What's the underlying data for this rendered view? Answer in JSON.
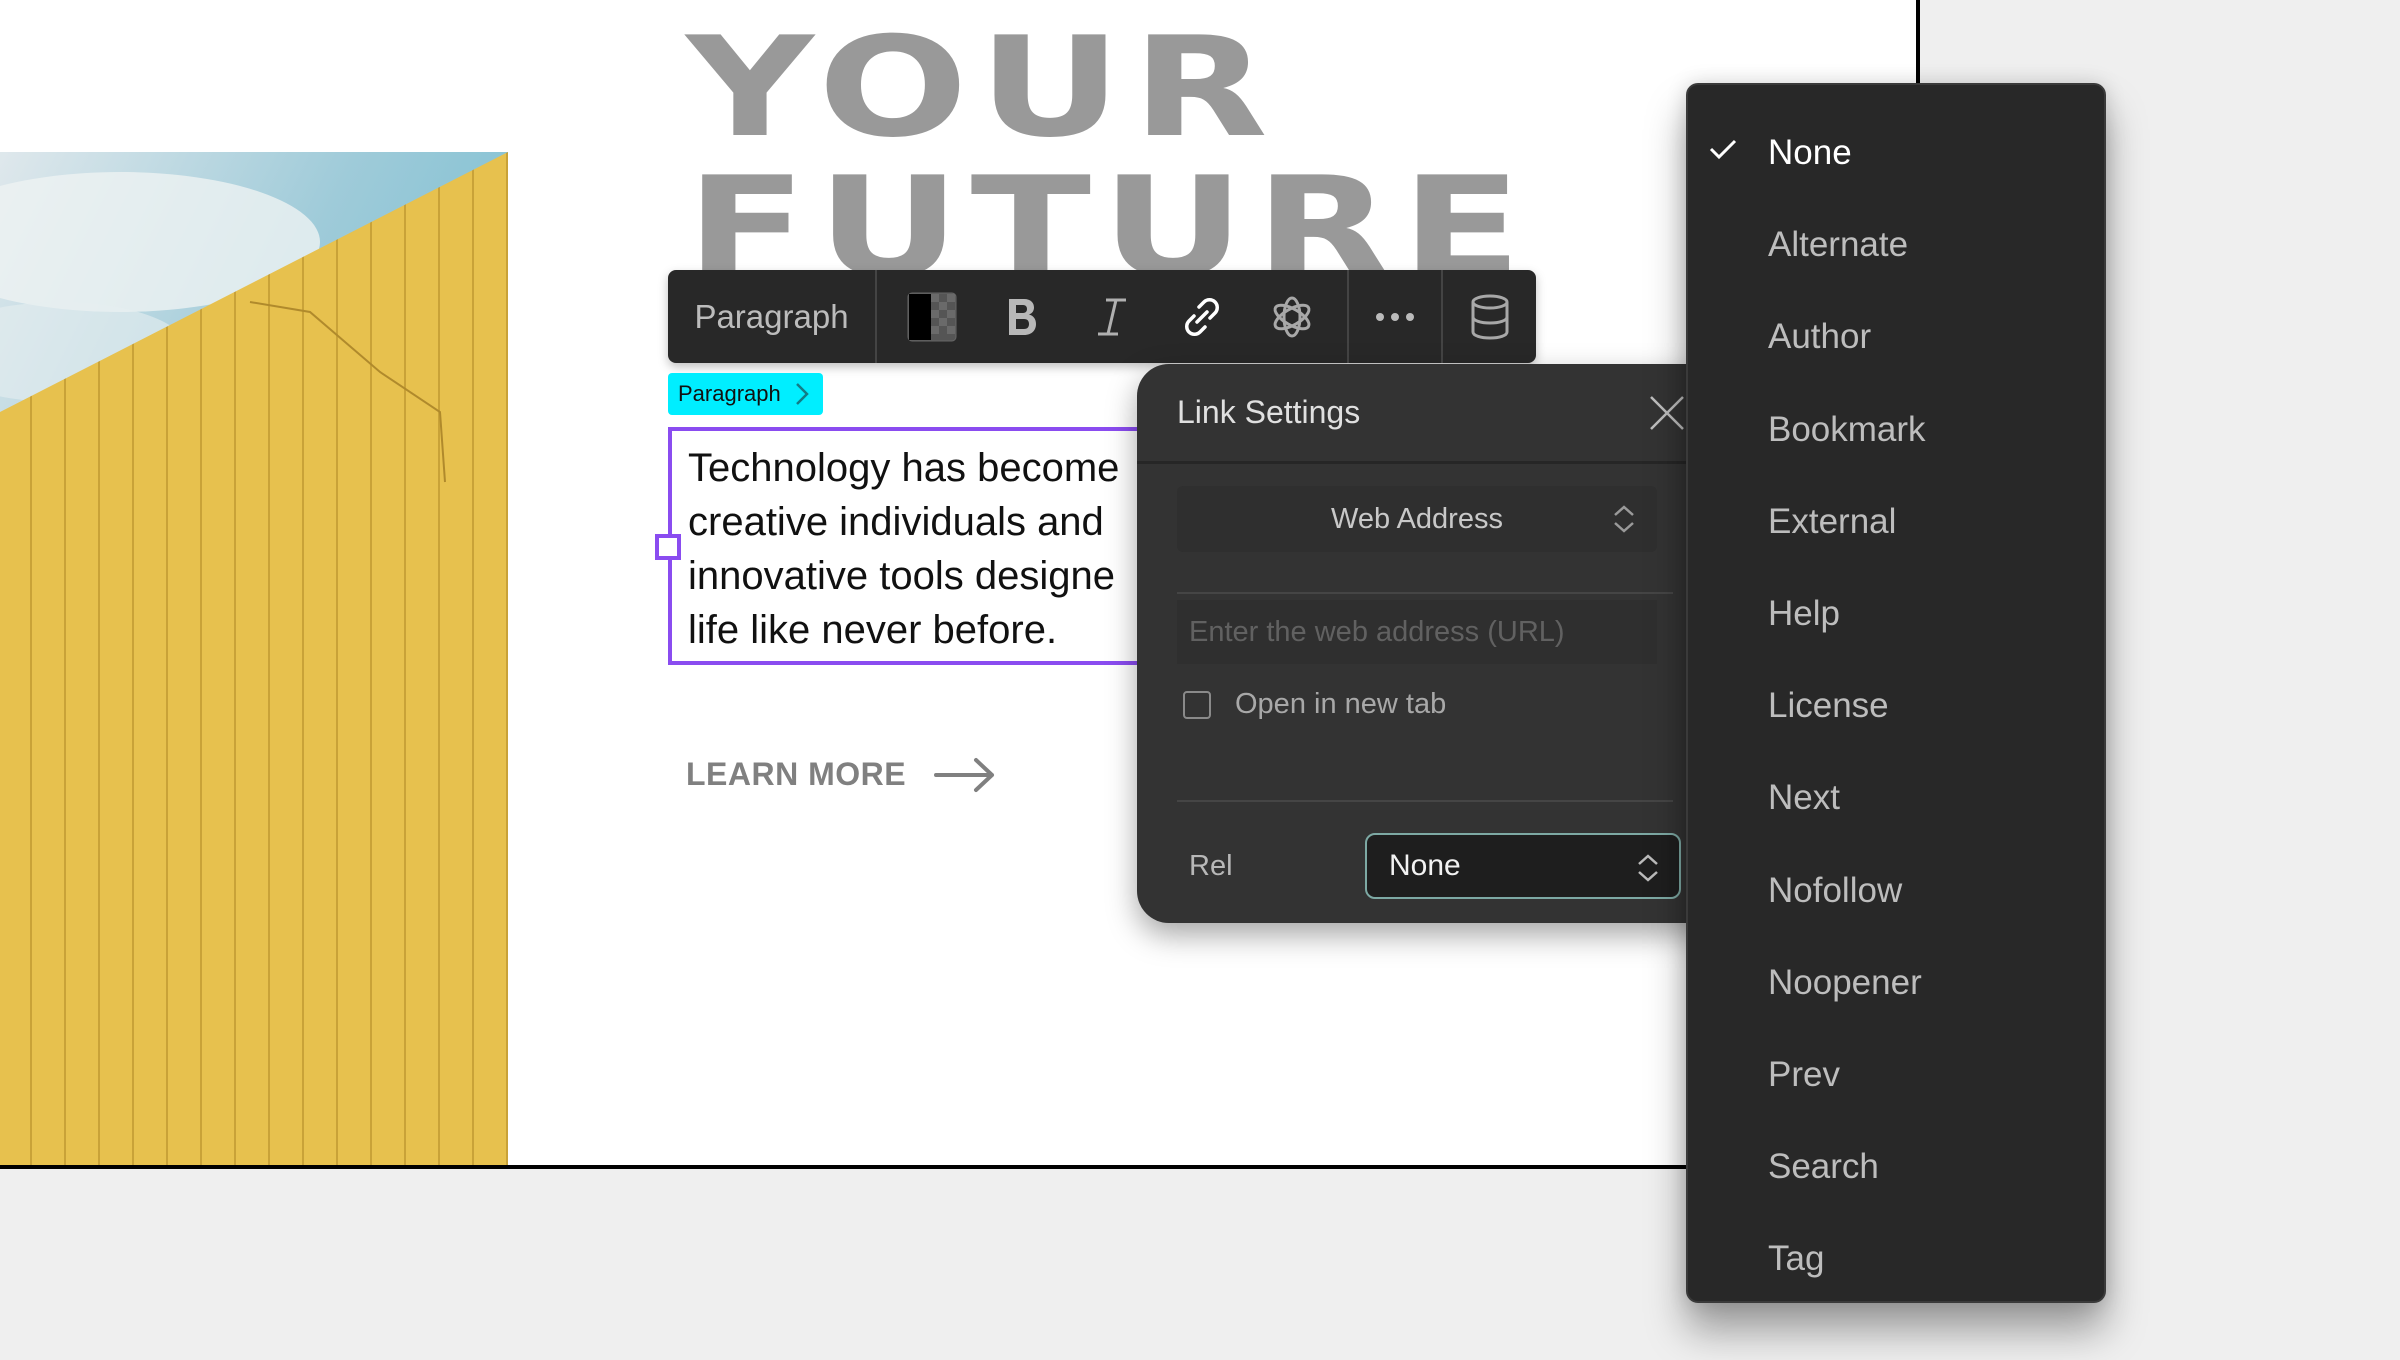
{
  "canvas": {
    "headline": [
      "YOUR",
      "FUTURE"
    ],
    "body_text_lines": [
      "Technology has become",
      "creative individuals and",
      "innovative tools designe",
      "life like never before."
    ],
    "cta": {
      "label": "LEARN MORE",
      "icon": "arrow-right-icon"
    },
    "hero_image": {
      "description": "Yellow building wall against blue sky with clouds"
    }
  },
  "toolbar": {
    "element_type": "Paragraph",
    "buttons": [
      {
        "name": "color-swatch",
        "icon": "color-swatch-icon"
      },
      {
        "name": "bold",
        "icon": "bold-icon",
        "label": "B"
      },
      {
        "name": "italic",
        "icon": "italic-icon"
      },
      {
        "name": "link",
        "icon": "link-icon",
        "active": true
      },
      {
        "name": "ai",
        "icon": "openai-icon"
      },
      {
        "name": "more",
        "icon": "more-horizontal-icon"
      },
      {
        "name": "database",
        "icon": "database-icon"
      }
    ]
  },
  "breadcrumb_badge": {
    "label": "Paragraph",
    "icon": "chevron-right-icon"
  },
  "link_settings": {
    "title": "Link Settings",
    "link_type": "Web Address",
    "url_value": "",
    "url_placeholder": "Enter the web address (URL)",
    "open_new_tab_label": "Open in new tab",
    "open_new_tab_checked": false,
    "rel_label": "Rel",
    "rel_value": "None"
  },
  "rel_dropdown": {
    "selected": "None",
    "options": [
      "None",
      "Alternate",
      "Author",
      "Bookmark",
      "External",
      "Help",
      "License",
      "Next",
      "Nofollow",
      "Noopener",
      "Prev",
      "Search",
      "Tag"
    ]
  },
  "colors": {
    "selection": "#8a4cf0",
    "badge": "#00eeff",
    "panel_bg": "#333333",
    "dropdown_bg": "#282828",
    "toolbar_bg": "#282828",
    "headline": "#999999"
  }
}
